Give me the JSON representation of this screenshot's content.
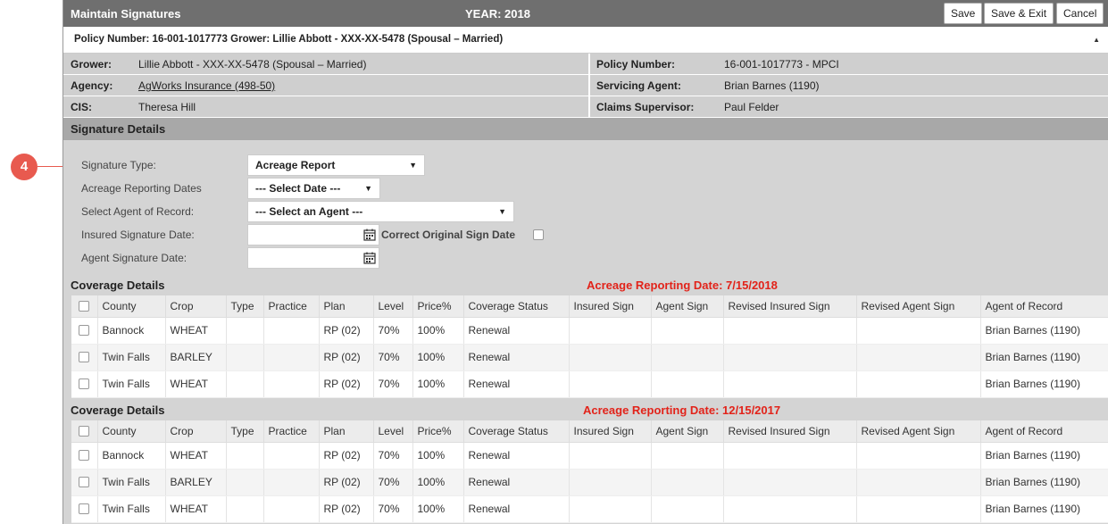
{
  "header": {
    "title": "Maintain Signatures",
    "year": "YEAR: 2018",
    "buttons": {
      "save": "Save",
      "save_exit": "Save & Exit",
      "cancel": "Cancel"
    }
  },
  "policy_bar": {
    "text": "Policy Number: 16-001-1017773 Grower: Lillie Abbott - XXX-XX-5478 (Spousal – Married)",
    "collapse_glyph": "▲"
  },
  "info": {
    "grower_label": "Grower:",
    "grower_value": "Lillie Abbott - XXX-XX-5478 (Spousal – Married)",
    "policy_label": "Policy Number:",
    "policy_value": "16-001-1017773 - MPCI",
    "agency_label": "Agency:",
    "agency_value": "AgWorks Insurance (498-50)",
    "servicing_label": "Servicing Agent:",
    "servicing_value": "Brian Barnes (1190)",
    "cis_label": "CIS:",
    "cis_value": "Theresa Hill",
    "claims_label": "Claims Supervisor:",
    "claims_value": "Paul Felder"
  },
  "signature_details": {
    "title": "Signature Details",
    "callout": "4",
    "signature_type_label": "Signature Type:",
    "signature_type_value": "Acreage Report",
    "ard_label": "Acreage Reporting Dates",
    "ard_value": "--- Select Date ---",
    "agent_label": "Select Agent of Record:",
    "agent_value": "--- Select an Agent ---",
    "insured_date_label": "Insured Signature Date:",
    "correct_label": "Correct Original Sign Date",
    "agent_date_label": "Agent Signature Date:"
  },
  "columns": [
    "County",
    "Crop",
    "Type",
    "Practice",
    "Plan",
    "Level",
    "Price%",
    "Coverage Status",
    "Insured Sign",
    "Agent Sign",
    "Revised Insured Sign",
    "Revised Agent Sign",
    "Agent of Record"
  ],
  "coverage_1": {
    "title": "Coverage Details",
    "ard": "Acreage Reporting Date: 7/15/2018",
    "rows": [
      [
        "Bannock",
        "WHEAT",
        "",
        "",
        "RP (02)",
        "70%",
        "100%",
        "Renewal",
        "",
        "",
        "",
        "",
        "Brian Barnes (1190)"
      ],
      [
        "Twin Falls",
        "BARLEY",
        "",
        "",
        "RP (02)",
        "70%",
        "100%",
        "Renewal",
        "",
        "",
        "",
        "",
        "Brian Barnes (1190)"
      ],
      [
        "Twin Falls",
        "WHEAT",
        "",
        "",
        "RP (02)",
        "70%",
        "100%",
        "Renewal",
        "",
        "",
        "",
        "",
        "Brian Barnes (1190)"
      ]
    ]
  },
  "coverage_2": {
    "title": "Coverage Details",
    "ard": "Acreage Reporting Date: 12/15/2017",
    "rows": [
      [
        "Bannock",
        "WHEAT",
        "",
        "",
        "RP (02)",
        "70%",
        "100%",
        "Renewal",
        "",
        "",
        "",
        "",
        "Brian Barnes (1190)"
      ],
      [
        "Twin Falls",
        "BARLEY",
        "",
        "",
        "RP (02)",
        "70%",
        "100%",
        "Renewal",
        "",
        "",
        "",
        "",
        "Brian Barnes (1190)"
      ],
      [
        "Twin Falls",
        "WHEAT",
        "",
        "",
        "RP (02)",
        "70%",
        "100%",
        "Renewal",
        "",
        "",
        "",
        "",
        "Brian Barnes (1190)"
      ]
    ]
  }
}
